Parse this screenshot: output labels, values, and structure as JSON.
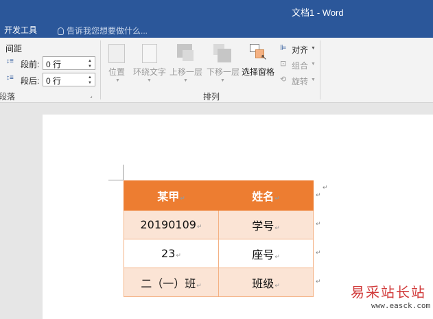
{
  "window": {
    "title": "文档1 - Word"
  },
  "tabs": {
    "developer": "开发工具"
  },
  "tell_me": {
    "placeholder": "告诉我您想要做什么..."
  },
  "paragraph_group": {
    "spacing_label": "间距",
    "before_label": "段前:",
    "before_value": "0 行",
    "after_label": "段后:",
    "after_value": "0 行",
    "group_label": "段落"
  },
  "arrange_group": {
    "position": "位置",
    "wrap_text": "环绕文字",
    "bring_forward": "上移一层",
    "send_backward": "下移一层",
    "selection_pane": "选择窗格",
    "align": "对齐",
    "group": "组合",
    "rotate": "旋转",
    "group_label": "排列"
  },
  "table": {
    "header": [
      "某甲",
      "姓名"
    ],
    "rows": [
      [
        "20190109",
        "学号"
      ],
      [
        "23",
        "座号"
      ],
      [
        "二（一）班",
        "班级"
      ]
    ]
  },
  "watermark": {
    "text": "易采站长站",
    "url": "www.easck.com"
  },
  "colors": {
    "title_bar": "#2b579a",
    "table_header": "#ed7d31",
    "table_band": "#fbe4d5"
  }
}
